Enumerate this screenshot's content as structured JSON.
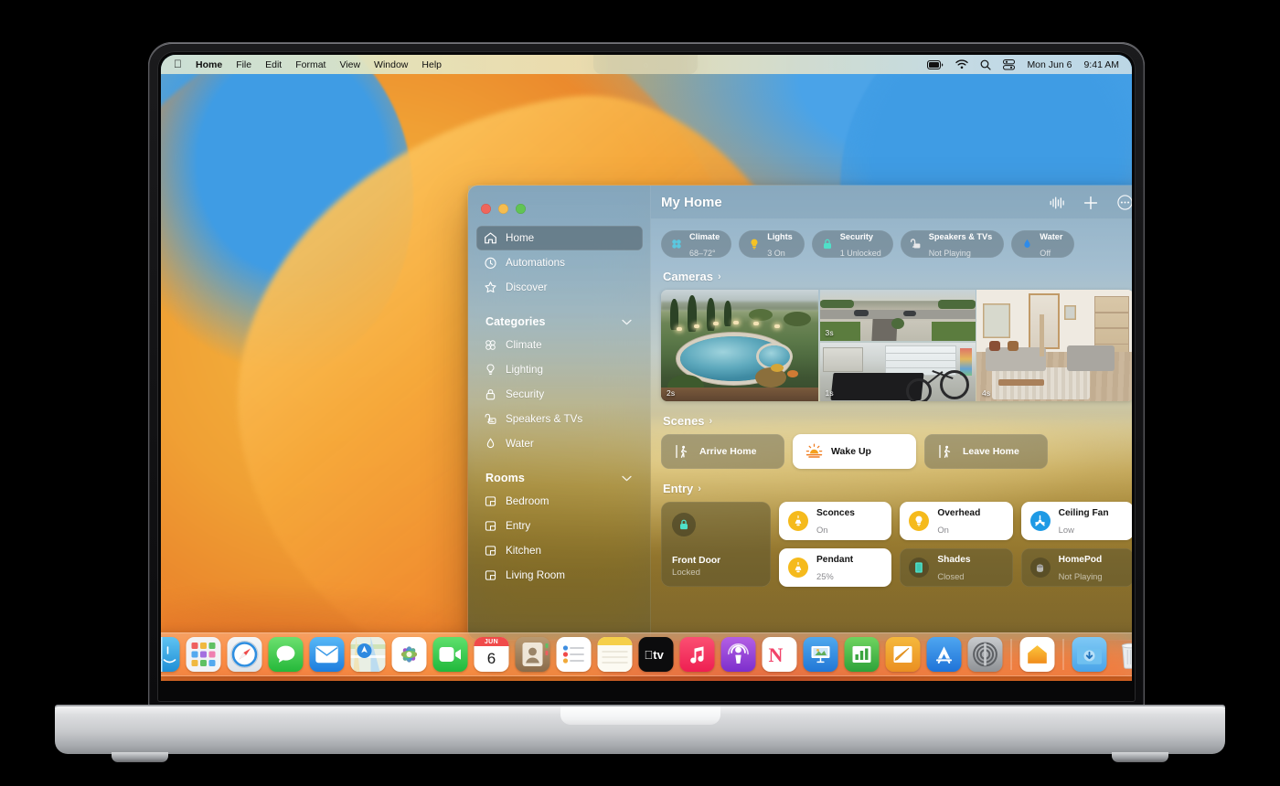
{
  "menubar": {
    "apple_icon": "apple-logo-icon",
    "items": [
      "Home",
      "File",
      "Edit",
      "Format",
      "View",
      "Window",
      "Help"
    ],
    "status_icons": [
      "battery-icon",
      "wifi-icon",
      "search-icon",
      "control-center-icon"
    ],
    "date": "Mon Jun 6",
    "time": "9:41 AM"
  },
  "window": {
    "title": "My Home",
    "traffic_lights": [
      "close-button",
      "minimize-button",
      "zoom-button"
    ],
    "actions": [
      {
        "name": "siri-waveform-button",
        "icon": "siri-waveform-icon"
      },
      {
        "name": "add-button",
        "icon": "plus-icon"
      },
      {
        "name": "more-options-button",
        "icon": "ellipsis-circle-icon"
      }
    ]
  },
  "sidebar": {
    "top_items": [
      {
        "label": "Home",
        "icon": "house-icon",
        "selected": true
      },
      {
        "label": "Automations",
        "icon": "clock-icon",
        "selected": false
      },
      {
        "label": "Discover",
        "icon": "star-icon",
        "selected": false
      }
    ],
    "groups": [
      {
        "title": "Categories",
        "chevron": "chevron-down-icon",
        "items": [
          {
            "label": "Climate",
            "icon": "fan-icon"
          },
          {
            "label": "Lighting",
            "icon": "bulb-icon"
          },
          {
            "label": "Security",
            "icon": "lock-icon"
          },
          {
            "label": "Speakers & TVs",
            "icon": "speaker-tv-icon"
          },
          {
            "label": "Water",
            "icon": "droplet-icon"
          }
        ]
      },
      {
        "title": "Rooms",
        "chevron": "chevron-down-icon",
        "items": [
          {
            "label": "Bedroom",
            "icon": "room-icon"
          },
          {
            "label": "Entry",
            "icon": "room-icon"
          },
          {
            "label": "Kitchen",
            "icon": "room-icon"
          },
          {
            "label": "Living Room",
            "icon": "room-icon"
          }
        ]
      }
    ]
  },
  "status_pills": [
    {
      "title": "Climate",
      "status": "68–72°",
      "icon": "fan-icon",
      "color": "#5ac8e0"
    },
    {
      "title": "Lights",
      "status": "3 On",
      "icon": "bulb-icon",
      "color": "#f5c324"
    },
    {
      "title": "Security",
      "status": "1 Unlocked",
      "icon": "lock-icon",
      "color": "#4fe0c8"
    },
    {
      "title": "Speakers & TVs",
      "status": "Not Playing",
      "icon": "speaker-tv-icon",
      "color": "#e8e8ea"
    },
    {
      "title": "Water",
      "status": "Off",
      "icon": "droplet-icon",
      "color": "#2e8bea"
    }
  ],
  "sections": {
    "cameras": {
      "title": "Cameras",
      "chevron": "chevron-right-icon"
    },
    "scenes": {
      "title": "Scenes",
      "chevron": "chevron-right-icon"
    },
    "entry": {
      "title": "Entry",
      "chevron": "chevron-right-icon"
    }
  },
  "cameras": [
    {
      "name": "pool-camera",
      "timestamp": "2s"
    },
    {
      "name": "driveway-camera",
      "timestamp": "3s"
    },
    {
      "name": "garage-camera",
      "timestamp": "1s"
    },
    {
      "name": "living-room-camera",
      "timestamp": "4s"
    }
  ],
  "scenes": [
    {
      "label": "Arrive Home",
      "icon": "walk-in-icon",
      "active": false
    },
    {
      "label": "Wake Up",
      "icon": "sunrise-icon",
      "active": true
    },
    {
      "label": "Leave Home",
      "icon": "walk-out-icon",
      "active": false
    }
  ],
  "entry_accessories": {
    "lock": {
      "name": "Front Door",
      "status": "Locked",
      "icon": "lock-icon",
      "color": "#4fe0c8"
    },
    "tiles": [
      {
        "name": "Sconces",
        "status": "On",
        "icon": "sconce-icon",
        "on": true,
        "color": "#f5ba1c"
      },
      {
        "name": "Overhead",
        "status": "On",
        "icon": "bulb-icon",
        "on": true,
        "color": "#f5ba1c"
      },
      {
        "name": "Ceiling Fan",
        "status": "Low",
        "icon": "fan-blade-icon",
        "on": true,
        "color": "#1e9ae5"
      },
      {
        "name": "Pendant",
        "status": "25%",
        "icon": "pendant-icon",
        "on": true,
        "color": "#f5ba1c"
      },
      {
        "name": "Shades",
        "status": "Closed",
        "icon": "shade-icon",
        "on": false,
        "color": "#4fe0c8"
      },
      {
        "name": "HomePod",
        "status": "Not Playing",
        "icon": "homepod-icon",
        "on": false,
        "color": "#b9b8b2"
      }
    ]
  },
  "dock": {
    "items": [
      {
        "name": "finder",
        "label": "Finder"
      },
      {
        "name": "launchpad",
        "label": "Launchpad"
      },
      {
        "name": "safari",
        "label": "Safari"
      },
      {
        "name": "messages",
        "label": "Messages"
      },
      {
        "name": "mail",
        "label": "Mail"
      },
      {
        "name": "maps",
        "label": "Maps"
      },
      {
        "name": "photos",
        "label": "Photos"
      },
      {
        "name": "facetime",
        "label": "FaceTime"
      },
      {
        "name": "calendar",
        "label": "Calendar",
        "month": "JUN",
        "day": "6"
      },
      {
        "name": "contacts",
        "label": "Contacts"
      },
      {
        "name": "reminders",
        "label": "Reminders"
      },
      {
        "name": "notes",
        "label": "Notes"
      },
      {
        "name": "tv",
        "label": "TV"
      },
      {
        "name": "music",
        "label": "Music"
      },
      {
        "name": "podcasts",
        "label": "Podcasts"
      },
      {
        "name": "news",
        "label": "News"
      },
      {
        "name": "keynote",
        "label": "Keynote"
      },
      {
        "name": "numbers",
        "label": "Numbers"
      },
      {
        "name": "pages",
        "label": "Pages"
      },
      {
        "name": "app-store",
        "label": "App Store"
      },
      {
        "name": "system-settings",
        "label": "System Settings"
      },
      {
        "name": "home",
        "label": "Home",
        "running": true
      },
      {
        "name": "downloads",
        "label": "Downloads"
      },
      {
        "name": "trash",
        "label": "Trash"
      }
    ]
  }
}
